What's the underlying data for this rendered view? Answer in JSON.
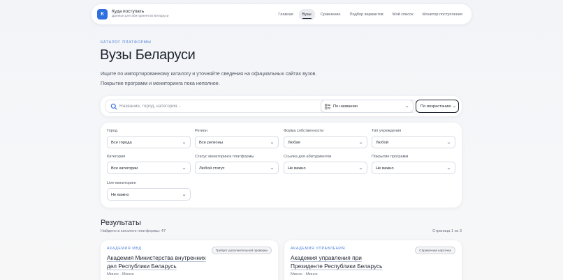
{
  "brand": {
    "logo": "К",
    "title": "Куда поступать",
    "subtitle": "Данные для абитуриентов Беларуси"
  },
  "nav": [
    "Главная",
    "Вузы",
    "Сравнение",
    "Подбор вариантов",
    "Мой список",
    "Монитор поступления"
  ],
  "nav_active": "Вузы",
  "hero": {
    "kicker": "КАТАЛОГ ПЛАТФОРМЫ",
    "title": "Вузы Беларуси",
    "subtitle_1": "Ищите по импортированному каталогу и уточняйте сведения на официальных сайтах вузов.",
    "subtitle_2": "Покрытие программ и мониторинга пока неполное."
  },
  "search": {
    "placeholder": "Название, город, категория...",
    "sort_value": "По названию",
    "order_value": "По возрастанию"
  },
  "filters": [
    {
      "label": "Город",
      "value": "Все города"
    },
    {
      "label": "Регион",
      "value": "Все регионы"
    },
    {
      "label": "Форма собственности",
      "value": "Любая"
    },
    {
      "label": "Тип учреждения",
      "value": "Любой"
    },
    {
      "label": "Категория",
      "value": "Все категории"
    },
    {
      "label": "Статус мониторинга платформы",
      "value": "Любой статус"
    },
    {
      "label": "Ссылка для абитуриентов",
      "value": "Не важно"
    },
    {
      "label": "Покрытие программ",
      "value": "Не важно"
    },
    {
      "label": "Live-мониторинг",
      "value": "Не важно"
    }
  ],
  "results": {
    "heading": "Результаты",
    "count": "Найдено в каталоге платформы: 47",
    "page": "Страница 1 из 3"
  },
  "cards": [
    {
      "category": "АКАДЕМИЯ МВД",
      "badge": "Требует дополнительной проверки",
      "title": "Академия Министерства внутренних дел Республики Беларусь",
      "location": "Минск · Минск"
    },
    {
      "category": "АКАДЕМИЯ УПРАВЛЕНИЯ",
      "badge": "Справочная карточка",
      "title": "Академия управления при Президенте Республики Беларусь",
      "location": "Минск · Минск"
    }
  ],
  "colors": {
    "accent": "#2f6fe0",
    "kicker": "#4c7fd8"
  }
}
